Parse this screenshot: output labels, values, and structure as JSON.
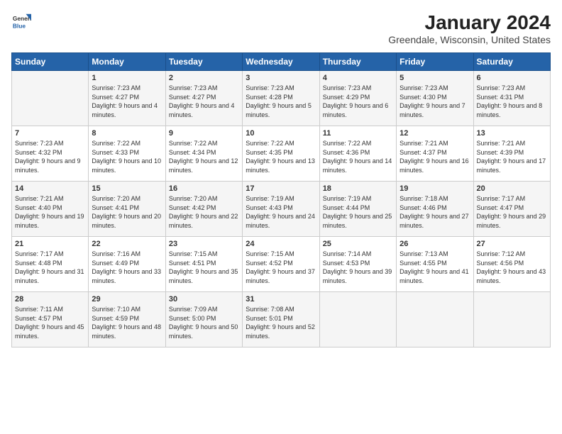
{
  "logo": {
    "general": "General",
    "blue": "Blue"
  },
  "title": "January 2024",
  "subtitle": "Greendale, Wisconsin, United States",
  "days_of_week": [
    "Sunday",
    "Monday",
    "Tuesday",
    "Wednesday",
    "Thursday",
    "Friday",
    "Saturday"
  ],
  "weeks": [
    [
      {
        "day": "",
        "sunrise": "",
        "sunset": "",
        "daylight": ""
      },
      {
        "day": "1",
        "sunrise": "Sunrise: 7:23 AM",
        "sunset": "Sunset: 4:27 PM",
        "daylight": "Daylight: 9 hours and 4 minutes."
      },
      {
        "day": "2",
        "sunrise": "Sunrise: 7:23 AM",
        "sunset": "Sunset: 4:27 PM",
        "daylight": "Daylight: 9 hours and 4 minutes."
      },
      {
        "day": "3",
        "sunrise": "Sunrise: 7:23 AM",
        "sunset": "Sunset: 4:28 PM",
        "daylight": "Daylight: 9 hours and 5 minutes."
      },
      {
        "day": "4",
        "sunrise": "Sunrise: 7:23 AM",
        "sunset": "Sunset: 4:29 PM",
        "daylight": "Daylight: 9 hours and 6 minutes."
      },
      {
        "day": "5",
        "sunrise": "Sunrise: 7:23 AM",
        "sunset": "Sunset: 4:30 PM",
        "daylight": "Daylight: 9 hours and 7 minutes."
      },
      {
        "day": "6",
        "sunrise": "Sunrise: 7:23 AM",
        "sunset": "Sunset: 4:31 PM",
        "daylight": "Daylight: 9 hours and 8 minutes."
      }
    ],
    [
      {
        "day": "7",
        "sunrise": "Sunrise: 7:23 AM",
        "sunset": "Sunset: 4:32 PM",
        "daylight": "Daylight: 9 hours and 9 minutes."
      },
      {
        "day": "8",
        "sunrise": "Sunrise: 7:22 AM",
        "sunset": "Sunset: 4:33 PM",
        "daylight": "Daylight: 9 hours and 10 minutes."
      },
      {
        "day": "9",
        "sunrise": "Sunrise: 7:22 AM",
        "sunset": "Sunset: 4:34 PM",
        "daylight": "Daylight: 9 hours and 12 minutes."
      },
      {
        "day": "10",
        "sunrise": "Sunrise: 7:22 AM",
        "sunset": "Sunset: 4:35 PM",
        "daylight": "Daylight: 9 hours and 13 minutes."
      },
      {
        "day": "11",
        "sunrise": "Sunrise: 7:22 AM",
        "sunset": "Sunset: 4:36 PM",
        "daylight": "Daylight: 9 hours and 14 minutes."
      },
      {
        "day": "12",
        "sunrise": "Sunrise: 7:21 AM",
        "sunset": "Sunset: 4:37 PM",
        "daylight": "Daylight: 9 hours and 16 minutes."
      },
      {
        "day": "13",
        "sunrise": "Sunrise: 7:21 AM",
        "sunset": "Sunset: 4:39 PM",
        "daylight": "Daylight: 9 hours and 17 minutes."
      }
    ],
    [
      {
        "day": "14",
        "sunrise": "Sunrise: 7:21 AM",
        "sunset": "Sunset: 4:40 PM",
        "daylight": "Daylight: 9 hours and 19 minutes."
      },
      {
        "day": "15",
        "sunrise": "Sunrise: 7:20 AM",
        "sunset": "Sunset: 4:41 PM",
        "daylight": "Daylight: 9 hours and 20 minutes."
      },
      {
        "day": "16",
        "sunrise": "Sunrise: 7:20 AM",
        "sunset": "Sunset: 4:42 PM",
        "daylight": "Daylight: 9 hours and 22 minutes."
      },
      {
        "day": "17",
        "sunrise": "Sunrise: 7:19 AM",
        "sunset": "Sunset: 4:43 PM",
        "daylight": "Daylight: 9 hours and 24 minutes."
      },
      {
        "day": "18",
        "sunrise": "Sunrise: 7:19 AM",
        "sunset": "Sunset: 4:44 PM",
        "daylight": "Daylight: 9 hours and 25 minutes."
      },
      {
        "day": "19",
        "sunrise": "Sunrise: 7:18 AM",
        "sunset": "Sunset: 4:46 PM",
        "daylight": "Daylight: 9 hours and 27 minutes."
      },
      {
        "day": "20",
        "sunrise": "Sunrise: 7:17 AM",
        "sunset": "Sunset: 4:47 PM",
        "daylight": "Daylight: 9 hours and 29 minutes."
      }
    ],
    [
      {
        "day": "21",
        "sunrise": "Sunrise: 7:17 AM",
        "sunset": "Sunset: 4:48 PM",
        "daylight": "Daylight: 9 hours and 31 minutes."
      },
      {
        "day": "22",
        "sunrise": "Sunrise: 7:16 AM",
        "sunset": "Sunset: 4:49 PM",
        "daylight": "Daylight: 9 hours and 33 minutes."
      },
      {
        "day": "23",
        "sunrise": "Sunrise: 7:15 AM",
        "sunset": "Sunset: 4:51 PM",
        "daylight": "Daylight: 9 hours and 35 minutes."
      },
      {
        "day": "24",
        "sunrise": "Sunrise: 7:15 AM",
        "sunset": "Sunset: 4:52 PM",
        "daylight": "Daylight: 9 hours and 37 minutes."
      },
      {
        "day": "25",
        "sunrise": "Sunrise: 7:14 AM",
        "sunset": "Sunset: 4:53 PM",
        "daylight": "Daylight: 9 hours and 39 minutes."
      },
      {
        "day": "26",
        "sunrise": "Sunrise: 7:13 AM",
        "sunset": "Sunset: 4:55 PM",
        "daylight": "Daylight: 9 hours and 41 minutes."
      },
      {
        "day": "27",
        "sunrise": "Sunrise: 7:12 AM",
        "sunset": "Sunset: 4:56 PM",
        "daylight": "Daylight: 9 hours and 43 minutes."
      }
    ],
    [
      {
        "day": "28",
        "sunrise": "Sunrise: 7:11 AM",
        "sunset": "Sunset: 4:57 PM",
        "daylight": "Daylight: 9 hours and 45 minutes."
      },
      {
        "day": "29",
        "sunrise": "Sunrise: 7:10 AM",
        "sunset": "Sunset: 4:59 PM",
        "daylight": "Daylight: 9 hours and 48 minutes."
      },
      {
        "day": "30",
        "sunrise": "Sunrise: 7:09 AM",
        "sunset": "Sunset: 5:00 PM",
        "daylight": "Daylight: 9 hours and 50 minutes."
      },
      {
        "day": "31",
        "sunrise": "Sunrise: 7:08 AM",
        "sunset": "Sunset: 5:01 PM",
        "daylight": "Daylight: 9 hours and 52 minutes."
      },
      {
        "day": "",
        "sunrise": "",
        "sunset": "",
        "daylight": ""
      },
      {
        "day": "",
        "sunrise": "",
        "sunset": "",
        "daylight": ""
      },
      {
        "day": "",
        "sunrise": "",
        "sunset": "",
        "daylight": ""
      }
    ]
  ],
  "accent_color": "#2563a8"
}
